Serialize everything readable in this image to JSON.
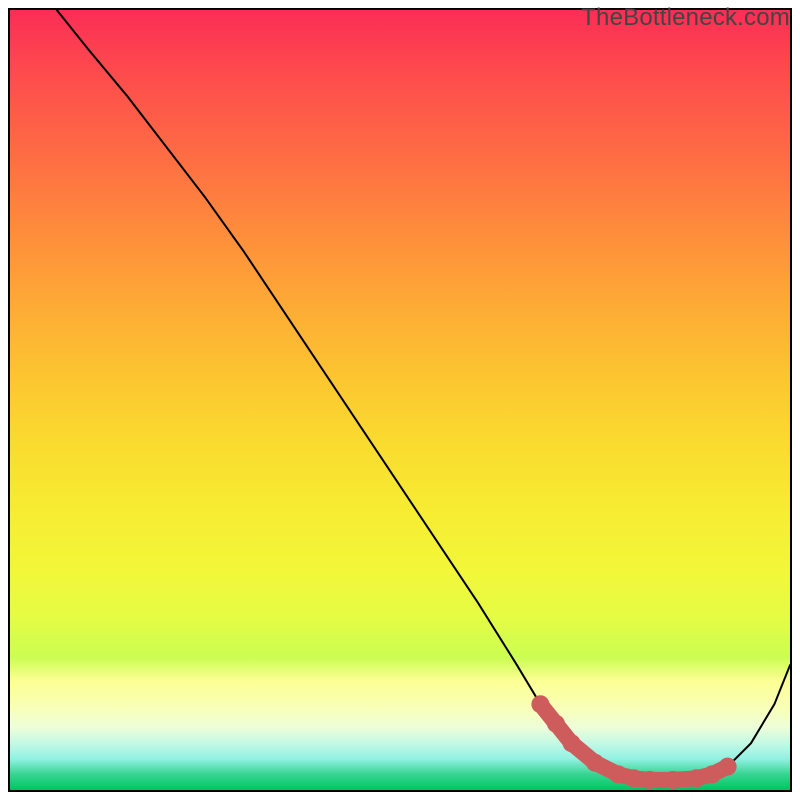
{
  "watermark": "TheBottleneck.com",
  "chart_data": {
    "type": "line",
    "title": "",
    "xlabel": "",
    "ylabel": "",
    "xlim": [
      0,
      100
    ],
    "ylim": [
      0,
      100
    ],
    "grid": false,
    "legend": false,
    "series": [
      {
        "name": "bottleneck-curve",
        "x": [
          6,
          10,
          15,
          20,
          25,
          30,
          35,
          40,
          45,
          50,
          55,
          60,
          65,
          68,
          70,
          72,
          75,
          78,
          80,
          82,
          85,
          88,
          90,
          92,
          95,
          98,
          100
        ],
        "y": [
          100,
          95,
          89,
          82.5,
          76,
          69,
          61.5,
          54,
          46.5,
          39,
          31.5,
          24,
          16,
          11,
          8.5,
          6,
          3.5,
          2,
          1.5,
          1.3,
          1.3,
          1.5,
          2,
          3,
          6,
          11,
          16
        ]
      }
    ],
    "highlighted_region": {
      "name": "optimal-zone",
      "x": [
        68,
        70,
        72,
        75,
        78,
        80,
        82,
        85,
        88,
        90,
        92
      ],
      "y": [
        11,
        8.5,
        6,
        3.5,
        2,
        1.5,
        1.3,
        1.3,
        1.5,
        2,
        3
      ]
    },
    "background_gradient": {
      "direction": "top-to-bottom",
      "stops": [
        {
          "pos": 0.0,
          "color": "#fc2d55"
        },
        {
          "pos": 0.5,
          "color": "#fad92f"
        },
        {
          "pos": 0.86,
          "color": "#fcff94"
        },
        {
          "pos": 1.0,
          "color": "#00c35f"
        }
      ]
    }
  }
}
